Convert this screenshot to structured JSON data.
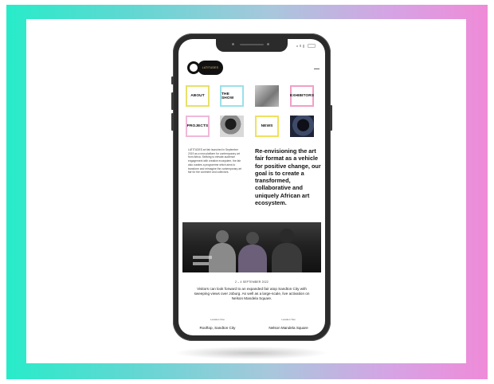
{
  "brand": {
    "logo_text": "LATITUDES"
  },
  "nav_tiles": [
    {
      "label": "ABOUT"
    },
    {
      "label": "THE SHOW"
    },
    {
      "label": "EXHIBITORS"
    },
    {
      "label": "PROJECTS"
    },
    {
      "label": "NEWS"
    }
  ],
  "intro_paragraph": "LATITUDES art fair launched in September 2019 as a new platform for contemporary art from Africa. Seeking to elevate audience engagement with creative ecosystem, the fair also curates a programme which aims to transform and reimagine the contemporary art fair for the continent and collectors.",
  "headline": "Re-envisioning the art fair format as a vehicle for positive change, our goal is to create a transformed, collaborative and uniquely African art ecosystem.",
  "event": {
    "date": "2 – 4 SEPTEMBER 2022",
    "description": "Visitors can look forward to an expanded fair atop Sandton City with sweeping views over Joburg. As well as a large-scale, live activation on Nelson Mandela Square."
  },
  "locations": [
    {
      "label": "Location One",
      "value": "Rooftop, Sandton City"
    },
    {
      "label": "Location Two",
      "value": "Nelson Mandela Square"
    }
  ],
  "colors": {
    "frame_gradient": [
      "#27ecc9",
      "#a8c7dc",
      "#ef8bd8"
    ],
    "phone_body": "#2b2b2b"
  }
}
